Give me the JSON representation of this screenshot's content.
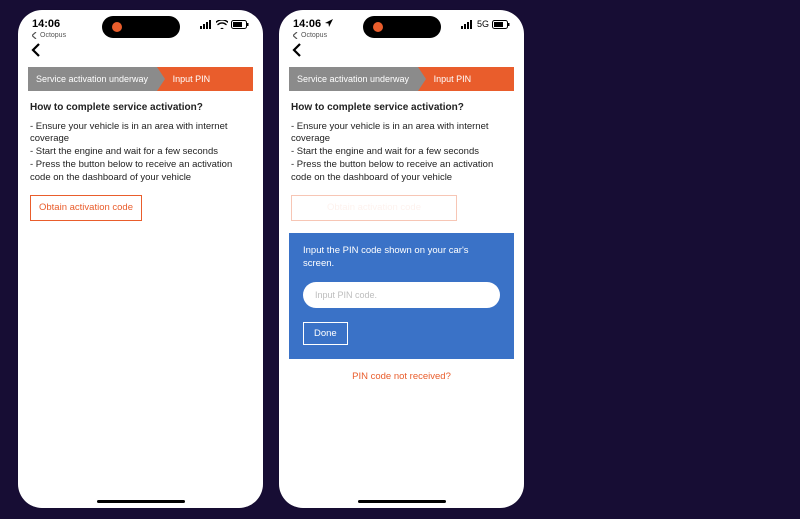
{
  "status": {
    "time": "14:06",
    "carrier": "Octopus",
    "net_right": "5G"
  },
  "progress": {
    "step1": "Service activation underway",
    "step2": "Input PIN"
  },
  "heading": "How to complete service activation?",
  "bullets": [
    "- Ensure your vehicle is in an area with internet coverage",
    "- Start the engine and wait for a few seconds",
    "- Press the button below to receive an activation code on the dashboard of your vehicle"
  ],
  "obtain_label": "Obtain activation code",
  "pin": {
    "prompt": "Input the PIN code shown on your car's screen.",
    "placeholder": "Input PIN code.",
    "done": "Done",
    "not_received": "PIN code not received?"
  }
}
